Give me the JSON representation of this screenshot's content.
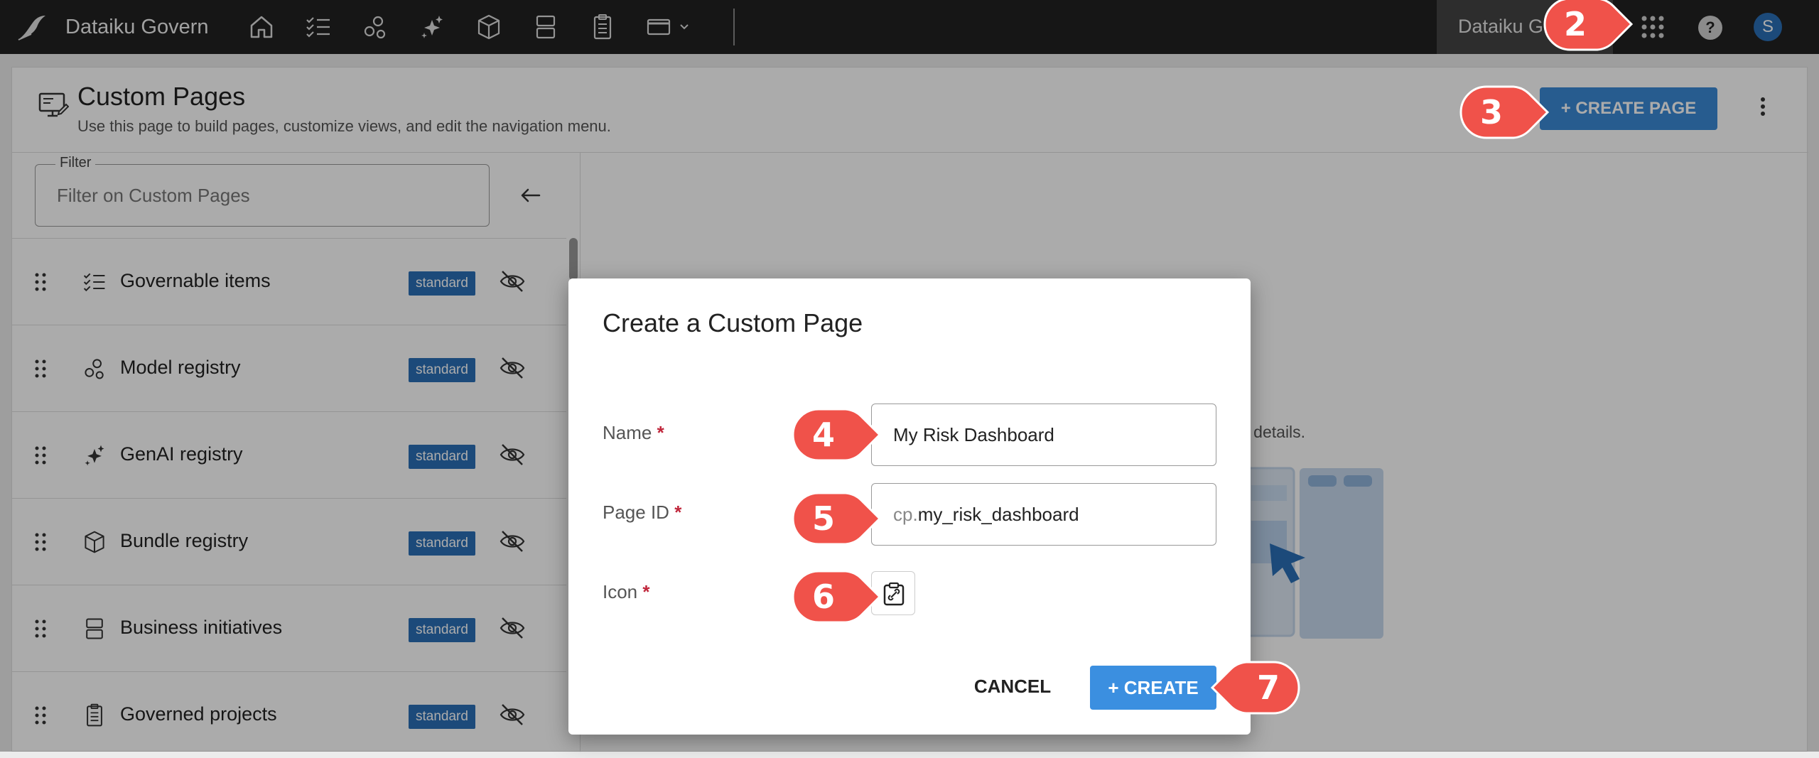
{
  "topbar": {
    "app_title": "Dataiku Govern",
    "instance_label": "Dataiku G",
    "help_label": "?",
    "avatar_initial": "S"
  },
  "page": {
    "title": "Custom Pages",
    "subtitle": "Use this page to build pages, customize views, and edit the navigation menu.",
    "create_page_label": "+ CREATE PAGE"
  },
  "filter": {
    "legend": "Filter",
    "placeholder": "Filter on Custom Pages"
  },
  "list_items": [
    {
      "label": "Governable items",
      "badge": "standard",
      "icon": "checklist-icon"
    },
    {
      "label": "Model registry",
      "badge": "standard",
      "icon": "model-nodes-icon"
    },
    {
      "label": "GenAI registry",
      "badge": "standard",
      "icon": "sparkle-icon"
    },
    {
      "label": "Bundle registry",
      "badge": "standard",
      "icon": "cube-icon"
    },
    {
      "label": "Business initiatives",
      "badge": "standard",
      "icon": "stacked-boxes-icon"
    },
    {
      "label": "Governed projects",
      "badge": "standard",
      "icon": "clipboard-icon"
    }
  ],
  "empty_state": {
    "text_fragment": "e details."
  },
  "modal": {
    "title": "Create a Custom Page",
    "name_label": "Name",
    "name_value": "My Risk Dashboard",
    "page_id_label": "Page ID",
    "page_id_prefix": "cp.",
    "page_id_value": "my_risk_dashboard",
    "icon_label": "Icon",
    "required_mark": "*",
    "cancel_label": "CANCEL",
    "create_label": "+ CREATE"
  },
  "callouts": [
    "2",
    "3",
    "4",
    "5",
    "6",
    "7"
  ],
  "colors": {
    "primary": "#3b89d6",
    "badge": "#2a6fb6",
    "callout": "#f0524a",
    "required": "#c0263b",
    "topbar": "#222222"
  }
}
